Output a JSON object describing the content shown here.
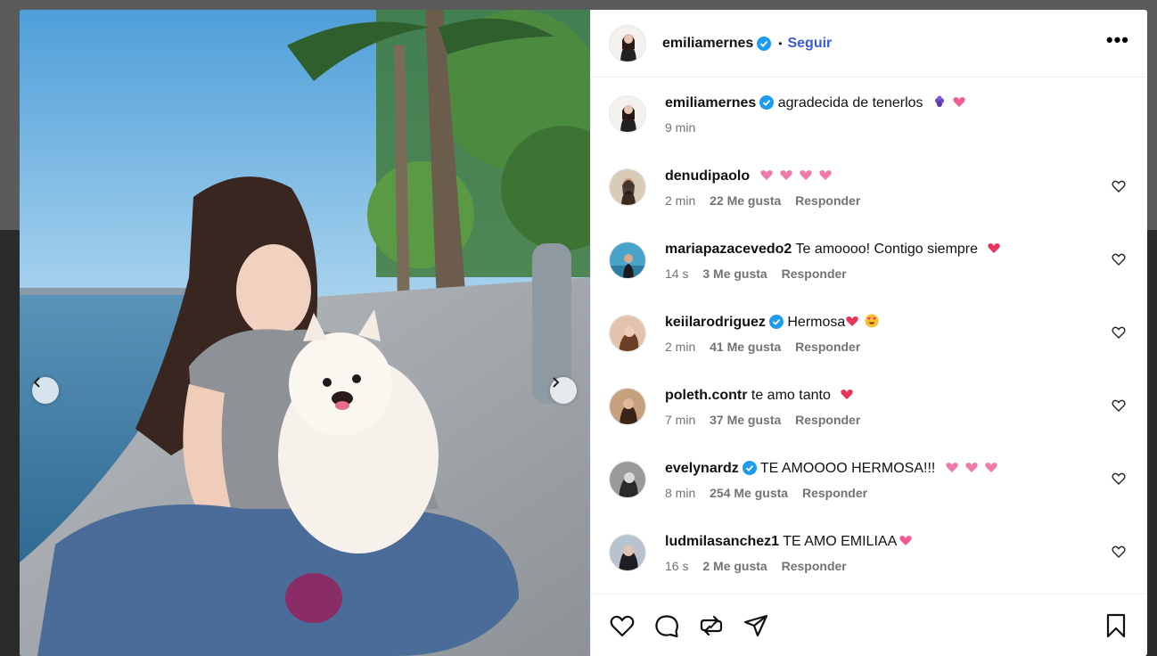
{
  "post": {
    "username": "emiliamernes",
    "follow_label": "Seguir",
    "dot": "•",
    "more_label": "•••",
    "caption_text": "agradecida de tenerlos",
    "caption_time": "9 min"
  },
  "comments": [
    {
      "user": "denudipaolo",
      "text": "",
      "time": "2 min",
      "likes": "22 Me gusta",
      "reply": "Responder"
    },
    {
      "user": "mariapazacevedo2",
      "text": "Te amoooo! Contigo siempre",
      "time": "14 s",
      "likes": "3 Me gusta",
      "reply": "Responder"
    },
    {
      "user": "keiilarodriguez",
      "text": "Hermosa",
      "time": "2 min",
      "likes": "41 Me gusta",
      "reply": "Responder"
    },
    {
      "user": "poleth.contr",
      "text": "te amo tanto",
      "time": "7 min",
      "likes": "37 Me gusta",
      "reply": "Responder"
    },
    {
      "user": "evelynardz",
      "text": "TE AMOOOO HERMOSA!!!",
      "time": "8 min",
      "likes": "254 Me gusta",
      "reply": "Responder"
    },
    {
      "user": "ludmilasanchez1",
      "text": "TE AMO EMILIAA",
      "time": "16 s",
      "likes": "2 Me gusta",
      "reply": "Responder"
    }
  ],
  "icons": {
    "verified": "verified-badge-icon",
    "heart": "heart-icon",
    "comment": "comment-icon",
    "repost": "repost-icon",
    "share": "share-icon",
    "save": "bookmark-icon",
    "prev": "chevron-left-icon",
    "next": "chevron-right-icon"
  },
  "colors": {
    "accent": "#3b5bd6",
    "verified": "#1d9bf0",
    "meta": "#737373",
    "emoji_heart": "#e8335d",
    "emoji_grapes": "#6b46c1"
  }
}
